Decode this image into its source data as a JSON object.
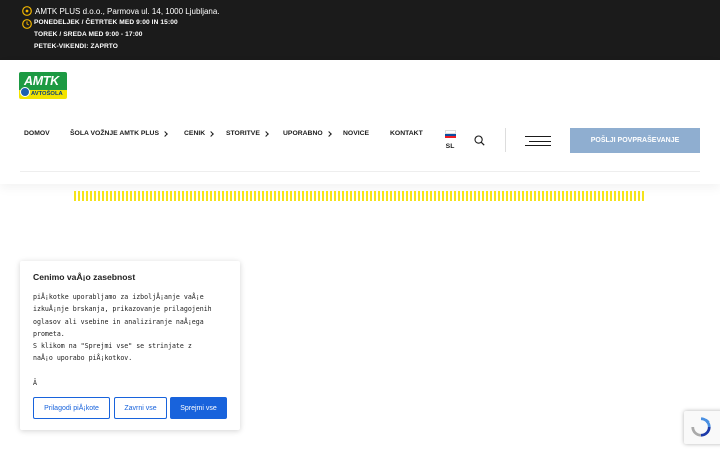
{
  "topbar": {
    "address": "AMTK PLUS d.o.o., Parmova ul. 14, 1000 Ljubljana.",
    "hours": [
      "PONEDELJEK / ČETRTEK MED 9:00 IN 15:00",
      "TOREK / SREDA MED 9:00 - 17:00",
      "PETEK-VIKENDI: ZAPRTO"
    ],
    "address_icon": "map-pin-icon",
    "hours_icon": "clock-icon"
  },
  "logo": {
    "main": "AMTK",
    "sub": "AVTOŠOLA",
    "colors": {
      "green": "#1d9a43",
      "yellow": "#f2e300",
      "blue": "#1e5fb0"
    }
  },
  "nav": {
    "items": [
      {
        "label": "DOMOV",
        "has_submenu": false
      },
      {
        "label": "ŠOLA VOŽNJE AMTK PLUS",
        "has_submenu": true
      },
      {
        "label": "CENIK",
        "has_submenu": true
      },
      {
        "label": "STORITVE",
        "has_submenu": true
      },
      {
        "label": "UPORABNO",
        "has_submenu": true
      },
      {
        "label": "NOVICE",
        "has_submenu": false
      },
      {
        "label": "KONTAKT",
        "has_submenu": false
      }
    ],
    "language": "SL",
    "cta_label": "POŠLJI POVPRAŠEVANJE",
    "cta_color": "#8faed0"
  },
  "cookie": {
    "title": "Cenimo vaÅ¡o zasebnost",
    "body_lines": [
      "piÅ¡kotke uporabljamo za izboljÅ¡anje vaÅ¡e",
      "izkuÅ¡nje brskanja, prikazovanje prilagojenih",
      "oglasov ali vsebine in analiziranje naÅ¡ega",
      "prometa.",
      "S klikom na \"Sprejmi vse\" se strinjate z",
      "naÅ¡o uporabo piÅ¡kotkov.",
      "",
      "Â"
    ],
    "buttons": {
      "customize": "Prilagodi piÅ¡kote",
      "reject": "Zavrni vse",
      "accept": "Sprejmi vse"
    },
    "accent": "#1863dc"
  },
  "colors": {
    "topbar_bg": "#1b1b1b",
    "topbar_icon": "#f0b400",
    "stripe": "#f4e31c"
  }
}
